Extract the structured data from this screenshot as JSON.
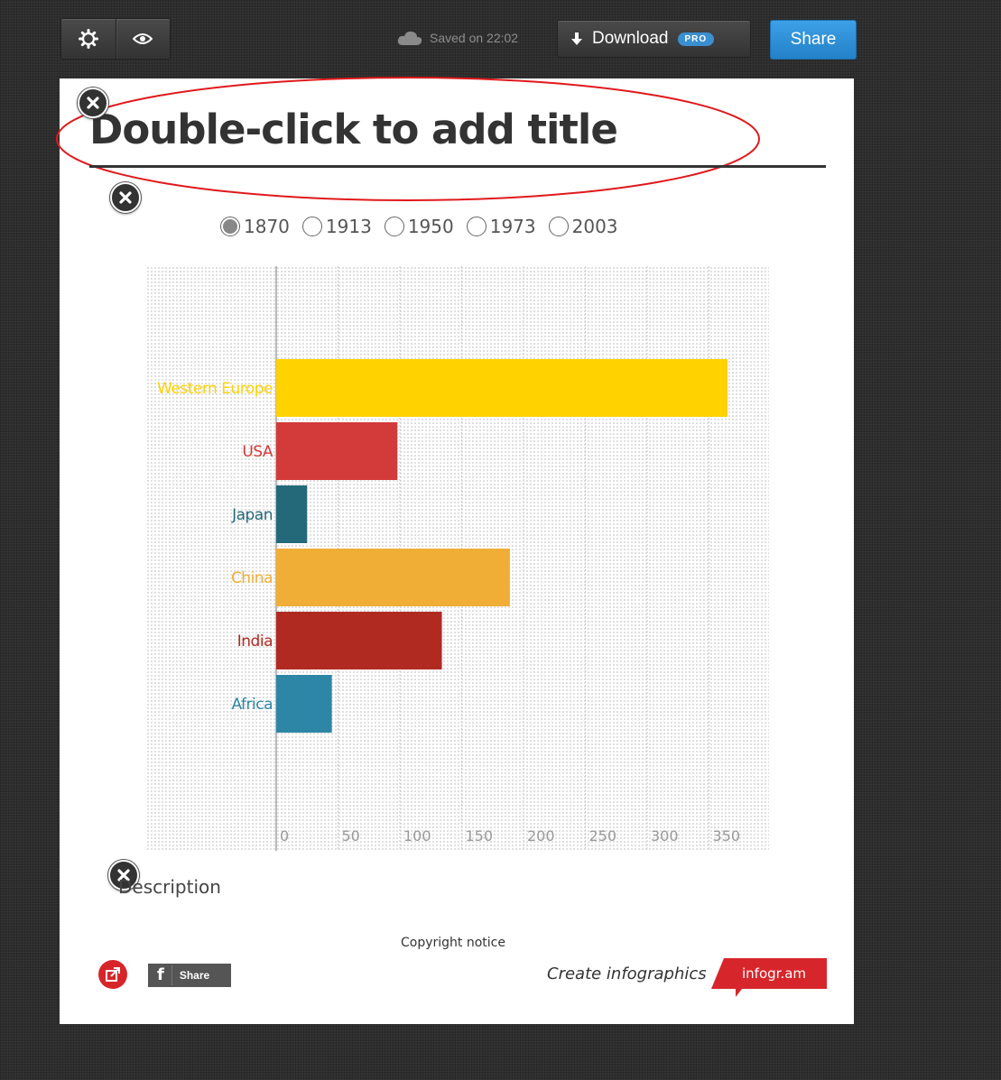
{
  "toolbar": {
    "settings_icon": "gear-icon",
    "preview_icon": "eye-icon",
    "saved_text": "Saved on 22:02",
    "download_label": "Download",
    "pro_badge": "PRO",
    "share_label": "Share"
  },
  "canvas": {
    "title": "Double-click to add title",
    "description": "Description",
    "copyright": "Copyright notice",
    "create_infographics": "Create infographics",
    "brand": "infogr.am",
    "fb_share": "Share"
  },
  "year_options": [
    {
      "label": "1870",
      "selected": true
    },
    {
      "label": "1913",
      "selected": false
    },
    {
      "label": "1950",
      "selected": false
    },
    {
      "label": "1973",
      "selected": false
    },
    {
      "label": "2003",
      "selected": false
    }
  ],
  "chart_data": {
    "type": "bar",
    "orientation": "horizontal",
    "title": "",
    "xlabel": "",
    "ylabel": "",
    "xlim": [
      0,
      350
    ],
    "xticks": [
      0,
      50,
      100,
      150,
      200,
      250,
      300,
      350
    ],
    "categories": [
      "Western Europe",
      "USA",
      "Japan",
      "China",
      "India",
      "Africa"
    ],
    "values": [
      365,
      98,
      25,
      189,
      134,
      45
    ],
    "colors": [
      "#ffd200",
      "#d33a3a",
      "#24697a",
      "#f0ae36",
      "#b12a22",
      "#2e86a6"
    ],
    "grid": true
  }
}
